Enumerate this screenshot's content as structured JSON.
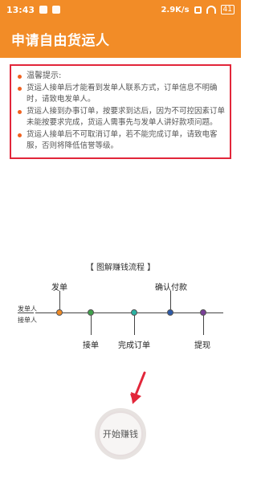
{
  "status_bar": {
    "time": "13:43",
    "speed": "2.9K/s",
    "battery": "41"
  },
  "header": {
    "title": "申请自由货运人"
  },
  "notice": {
    "title": "温馨提示:",
    "items": [
      "货运人接单后才能看到发单人联系方式，订单信息不明确时，请致电发单人。",
      "货运人接到办事订单，按要求到达后，因为不可控因素订单未能按要求完成，货运人需事先与发单人讲好款项问题。",
      "货运人接单后不可取消订单，若不能完成订单，请致电客服，否则将降低信誉等级。"
    ]
  },
  "flow": {
    "caption": "【 图解赚钱流程 】",
    "role_top": "发单人",
    "role_bottom": "接单人",
    "steps": {
      "publish": "发单",
      "accept": "接单",
      "complete": "完成订单",
      "confirm": "确认付款",
      "withdraw": "提现"
    }
  },
  "start_button": {
    "label": "开始赚钱"
  },
  "colors": {
    "accent": "#f28c27",
    "notice_border": "#e2263a",
    "bullet": "#f0611f"
  }
}
